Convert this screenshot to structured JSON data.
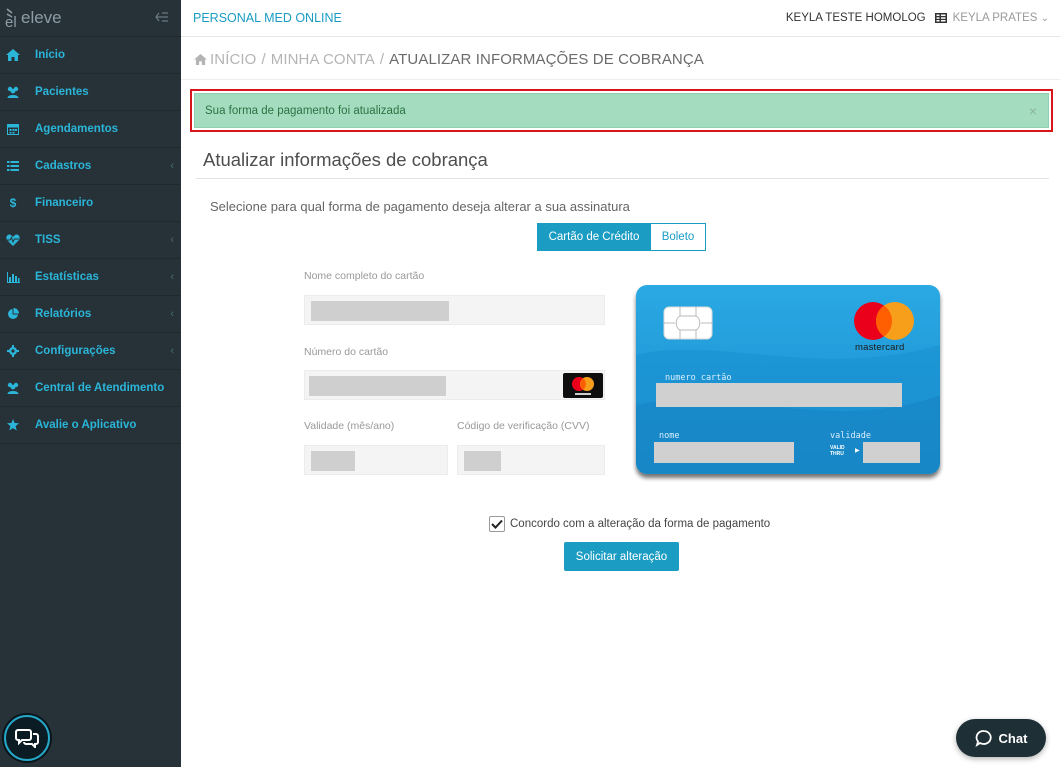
{
  "app": {
    "logo_text": "eleve",
    "brand": "PERSONAL MED ONLINE"
  },
  "header": {
    "account": "KEYLA TESTE HOMOLOG",
    "user": "KEYLA PRATES",
    "user_caret": "⌄"
  },
  "sidebar": {
    "items": [
      {
        "label": "Início",
        "icon": "home-icon",
        "has_caret": false
      },
      {
        "label": "Pacientes",
        "icon": "users-icon",
        "has_caret": false
      },
      {
        "label": "Agendamentos",
        "icon": "calendar-icon",
        "has_caret": false
      },
      {
        "label": "Cadastros",
        "icon": "list-icon",
        "has_caret": true
      },
      {
        "label": "Financeiro",
        "icon": "dollar-icon",
        "has_caret": false
      },
      {
        "label": "TISS",
        "icon": "heartbeat-icon",
        "has_caret": true
      },
      {
        "label": "Estatísticas",
        "icon": "bar-chart-icon",
        "has_caret": true
      },
      {
        "label": "Relatórios",
        "icon": "pie-chart-icon",
        "has_caret": true
      },
      {
        "label": "Configurações",
        "icon": "gear-icon",
        "has_caret": true
      },
      {
        "label": "Central de Atendimento",
        "icon": "users-icon",
        "has_caret": false
      },
      {
        "label": "Avalie o Aplicativo",
        "icon": "star-icon",
        "has_caret": false
      }
    ]
  },
  "breadcrumb": {
    "home": "INÍCIO",
    "sep": "/",
    "account": "MINHA CONTA",
    "current": "ATUALIZAR INFORMAÇÕES DE COBRANÇA"
  },
  "alert": {
    "message": "Sua forma de pagamento foi atualizada",
    "close": "×"
  },
  "page": {
    "title": "Atualizar informações de cobrança",
    "subtitle": "Selecione para qual forma de pagamento deseja alterar a sua assinatura"
  },
  "payment_toggle": {
    "credit": "Cartão de Crédito",
    "boleto": "Boleto",
    "selected": "credit"
  },
  "form": {
    "name_label": "Nome completo do cartão",
    "number_label": "Número do cartão",
    "expiry_label": "Validade (mês/ano)",
    "cvv_label": "Código de verificação (CVV)"
  },
  "card_preview": {
    "brand": "mastercard",
    "number_label": "numero cartão",
    "name_label": "nome",
    "valid_label": "validade",
    "valid_thru": "VALID THRU"
  },
  "agreement": {
    "label": "Concordo com a alteração da forma de pagamento",
    "checked": true
  },
  "submit_label": "Solicitar alteração",
  "chat_label": "Chat",
  "colors": {
    "sidebar_bg": "#263238",
    "accent": "#1a9cc3",
    "alert_bg": "#a3dcbf",
    "highlight_border": "#d6161b"
  }
}
